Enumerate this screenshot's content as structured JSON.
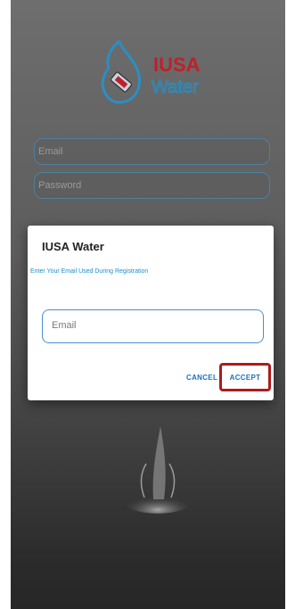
{
  "brand": {
    "name_top": "IUSA",
    "name_bottom": "Water"
  },
  "login": {
    "email_placeholder": "Email",
    "password_placeholder": "Password"
  },
  "dialog": {
    "title": "IUSA Water",
    "message": "Enter Your Email Used During Registration",
    "email_placeholder": "Email",
    "cancel_label": "CANCEL",
    "accept_label": "ACCEPT"
  },
  "colors": {
    "brand_red": "#c0202a",
    "brand_blue": "#2a8fc4",
    "button_text": "#1a73b8",
    "highlight": "#b01a1a"
  },
  "icons": [
    "water-drop-logo-icon",
    "water-splash-image"
  ]
}
